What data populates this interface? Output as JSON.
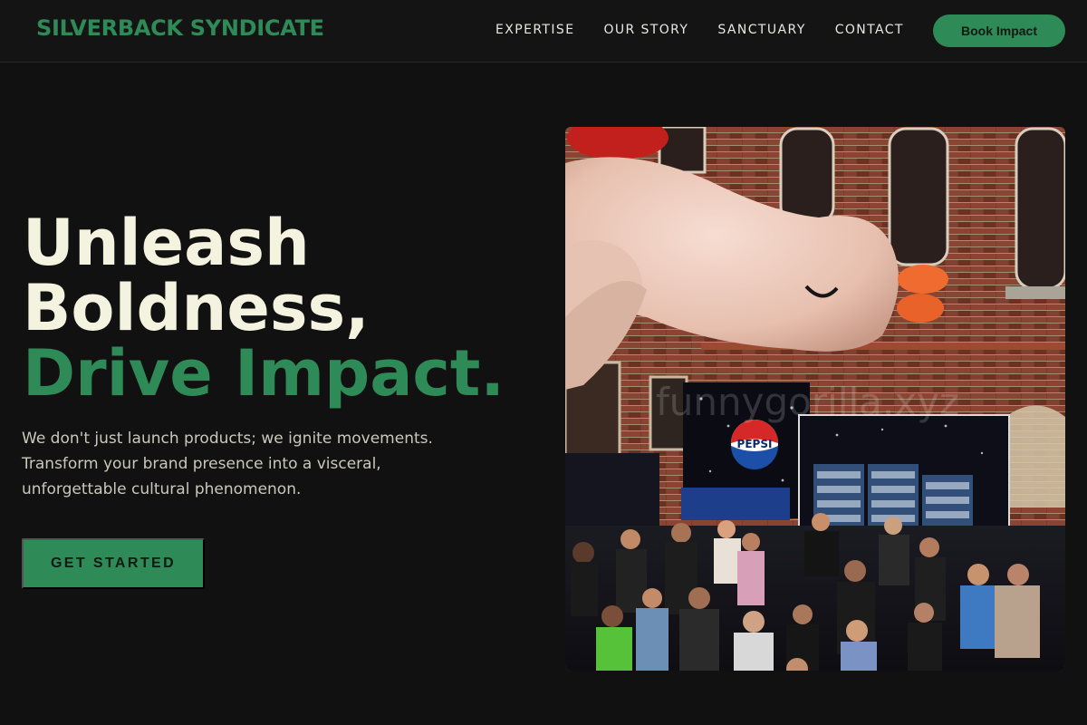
{
  "brand": {
    "name": "SILVERBACK SYNDICATE"
  },
  "nav": {
    "links": [
      "EXPERTISE",
      "OUR STORY",
      "SANCTUARY",
      "CONTACT"
    ],
    "cta_label": "Book Impact"
  },
  "hero": {
    "title_line1": "Unleash",
    "title_line2": "Boldness,",
    "title_line3": "Drive Impact.",
    "subtitle": "We don't just launch products; we ignite movements. Transform your brand presence into a visceral, unforgettable cultural phenomenon.",
    "cta_label": "GET STARTED",
    "image": {
      "watermark": "funnygorilla.xyz",
      "sign_text": "PEPSI"
    }
  },
  "colors": {
    "background": "#111111",
    "accent": "#2e8b57",
    "heading": "#f4f3e0",
    "body_text": "#c9c8bb"
  }
}
